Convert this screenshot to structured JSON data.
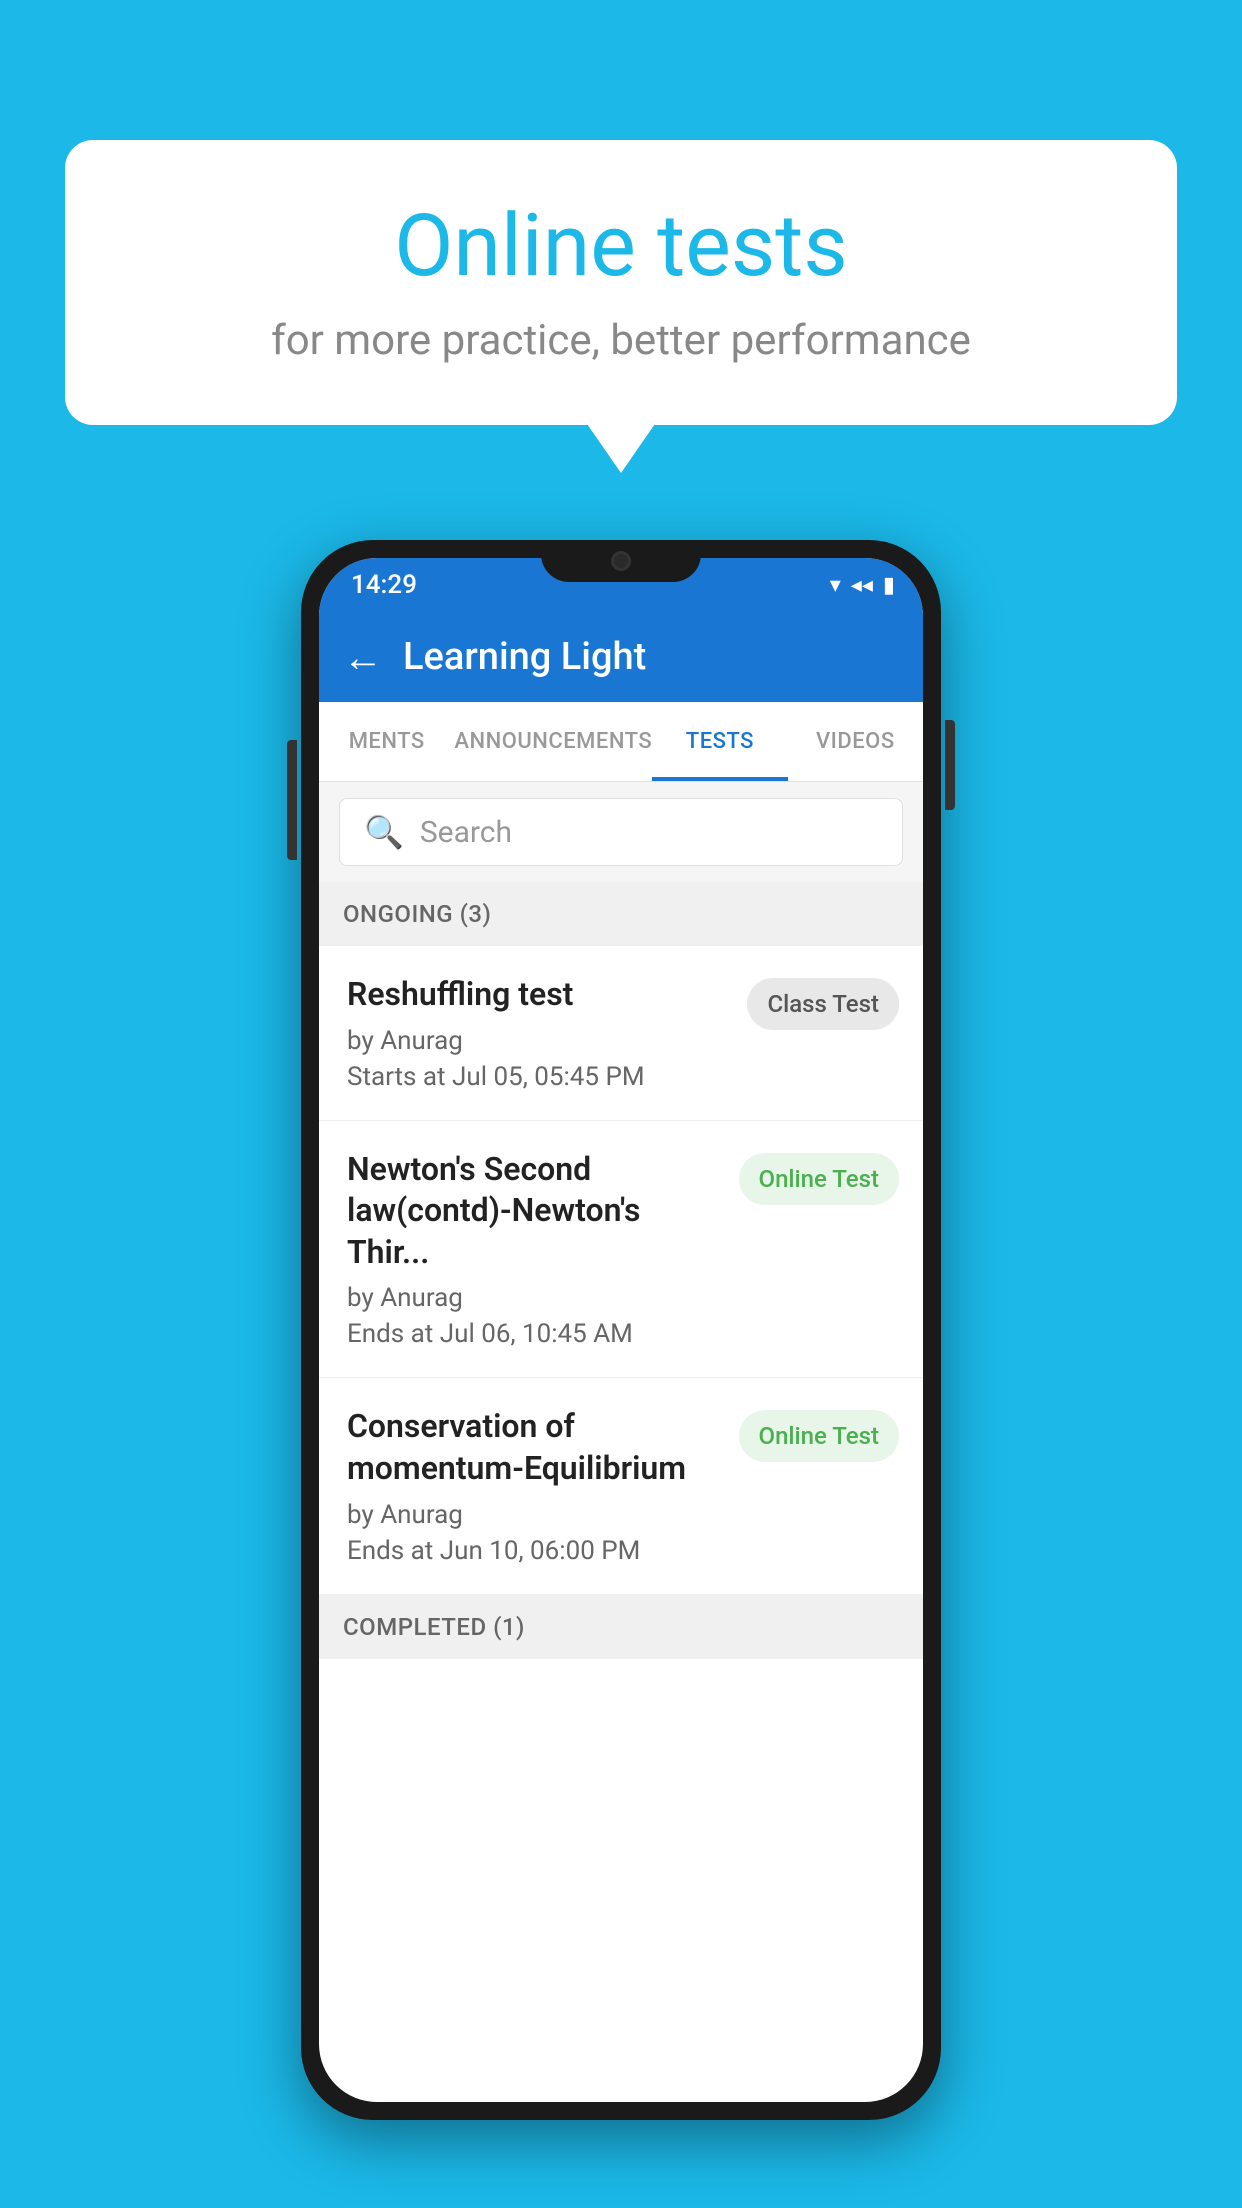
{
  "background": {
    "color": "#1bb8e8"
  },
  "speech_bubble": {
    "title": "Online tests",
    "subtitle": "for more practice, better performance"
  },
  "phone": {
    "status_bar": {
      "time": "14:29",
      "icons": [
        "wifi",
        "signal",
        "battery"
      ]
    },
    "app_bar": {
      "title": "Learning Light",
      "back_label": "←"
    },
    "tabs": [
      {
        "label": "MENTS",
        "active": false
      },
      {
        "label": "ANNOUNCEMENTS",
        "active": false
      },
      {
        "label": "TESTS",
        "active": true
      },
      {
        "label": "VIDEOS",
        "active": false
      }
    ],
    "search": {
      "placeholder": "Search"
    },
    "sections": [
      {
        "title": "ONGOING (3)",
        "items": [
          {
            "name": "Reshuffling test",
            "author": "by Anurag",
            "time_label": "Starts at",
            "time": "Jul 05, 05:45 PM",
            "badge": "Class Test",
            "badge_type": "class"
          },
          {
            "name": "Newton's Second law(contd)-Newton's Thir...",
            "author": "by Anurag",
            "time_label": "Ends at",
            "time": "Jul 06, 10:45 AM",
            "badge": "Online Test",
            "badge_type": "online"
          },
          {
            "name": "Conservation of momentum-Equilibrium",
            "author": "by Anurag",
            "time_label": "Ends at",
            "time": "Jun 10, 06:00 PM",
            "badge": "Online Test",
            "badge_type": "online"
          }
        ]
      }
    ],
    "bottom_section": {
      "title": "COMPLETED (1)"
    }
  }
}
